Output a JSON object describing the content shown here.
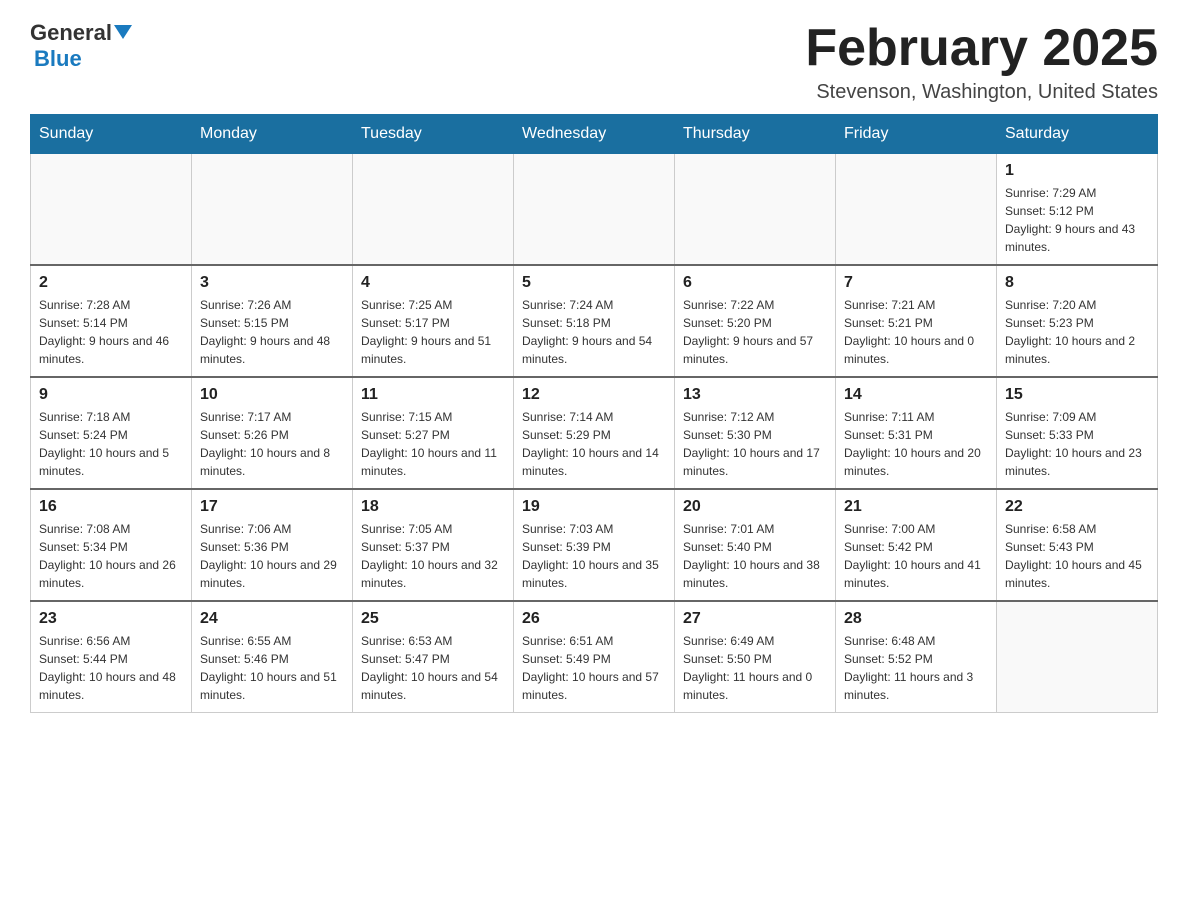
{
  "header": {
    "logo_general": "General",
    "logo_blue": "Blue",
    "month_title": "February 2025",
    "location": "Stevenson, Washington, United States"
  },
  "days_of_week": [
    "Sunday",
    "Monday",
    "Tuesday",
    "Wednesday",
    "Thursday",
    "Friday",
    "Saturday"
  ],
  "weeks": [
    [
      {
        "day": "",
        "info": "",
        "empty": true
      },
      {
        "day": "",
        "info": "",
        "empty": true
      },
      {
        "day": "",
        "info": "",
        "empty": true
      },
      {
        "day": "",
        "info": "",
        "empty": true
      },
      {
        "day": "",
        "info": "",
        "empty": true
      },
      {
        "day": "",
        "info": "",
        "empty": true
      },
      {
        "day": "1",
        "info": "Sunrise: 7:29 AM\nSunset: 5:12 PM\nDaylight: 9 hours and 43 minutes."
      }
    ],
    [
      {
        "day": "2",
        "info": "Sunrise: 7:28 AM\nSunset: 5:14 PM\nDaylight: 9 hours and 46 minutes."
      },
      {
        "day": "3",
        "info": "Sunrise: 7:26 AM\nSunset: 5:15 PM\nDaylight: 9 hours and 48 minutes."
      },
      {
        "day": "4",
        "info": "Sunrise: 7:25 AM\nSunset: 5:17 PM\nDaylight: 9 hours and 51 minutes."
      },
      {
        "day": "5",
        "info": "Sunrise: 7:24 AM\nSunset: 5:18 PM\nDaylight: 9 hours and 54 minutes."
      },
      {
        "day": "6",
        "info": "Sunrise: 7:22 AM\nSunset: 5:20 PM\nDaylight: 9 hours and 57 minutes."
      },
      {
        "day": "7",
        "info": "Sunrise: 7:21 AM\nSunset: 5:21 PM\nDaylight: 10 hours and 0 minutes."
      },
      {
        "day": "8",
        "info": "Sunrise: 7:20 AM\nSunset: 5:23 PM\nDaylight: 10 hours and 2 minutes."
      }
    ],
    [
      {
        "day": "9",
        "info": "Sunrise: 7:18 AM\nSunset: 5:24 PM\nDaylight: 10 hours and 5 minutes."
      },
      {
        "day": "10",
        "info": "Sunrise: 7:17 AM\nSunset: 5:26 PM\nDaylight: 10 hours and 8 minutes."
      },
      {
        "day": "11",
        "info": "Sunrise: 7:15 AM\nSunset: 5:27 PM\nDaylight: 10 hours and 11 minutes."
      },
      {
        "day": "12",
        "info": "Sunrise: 7:14 AM\nSunset: 5:29 PM\nDaylight: 10 hours and 14 minutes."
      },
      {
        "day": "13",
        "info": "Sunrise: 7:12 AM\nSunset: 5:30 PM\nDaylight: 10 hours and 17 minutes."
      },
      {
        "day": "14",
        "info": "Sunrise: 7:11 AM\nSunset: 5:31 PM\nDaylight: 10 hours and 20 minutes."
      },
      {
        "day": "15",
        "info": "Sunrise: 7:09 AM\nSunset: 5:33 PM\nDaylight: 10 hours and 23 minutes."
      }
    ],
    [
      {
        "day": "16",
        "info": "Sunrise: 7:08 AM\nSunset: 5:34 PM\nDaylight: 10 hours and 26 minutes."
      },
      {
        "day": "17",
        "info": "Sunrise: 7:06 AM\nSunset: 5:36 PM\nDaylight: 10 hours and 29 minutes."
      },
      {
        "day": "18",
        "info": "Sunrise: 7:05 AM\nSunset: 5:37 PM\nDaylight: 10 hours and 32 minutes."
      },
      {
        "day": "19",
        "info": "Sunrise: 7:03 AM\nSunset: 5:39 PM\nDaylight: 10 hours and 35 minutes."
      },
      {
        "day": "20",
        "info": "Sunrise: 7:01 AM\nSunset: 5:40 PM\nDaylight: 10 hours and 38 minutes."
      },
      {
        "day": "21",
        "info": "Sunrise: 7:00 AM\nSunset: 5:42 PM\nDaylight: 10 hours and 41 minutes."
      },
      {
        "day": "22",
        "info": "Sunrise: 6:58 AM\nSunset: 5:43 PM\nDaylight: 10 hours and 45 minutes."
      }
    ],
    [
      {
        "day": "23",
        "info": "Sunrise: 6:56 AM\nSunset: 5:44 PM\nDaylight: 10 hours and 48 minutes."
      },
      {
        "day": "24",
        "info": "Sunrise: 6:55 AM\nSunset: 5:46 PM\nDaylight: 10 hours and 51 minutes."
      },
      {
        "day": "25",
        "info": "Sunrise: 6:53 AM\nSunset: 5:47 PM\nDaylight: 10 hours and 54 minutes."
      },
      {
        "day": "26",
        "info": "Sunrise: 6:51 AM\nSunset: 5:49 PM\nDaylight: 10 hours and 57 minutes."
      },
      {
        "day": "27",
        "info": "Sunrise: 6:49 AM\nSunset: 5:50 PM\nDaylight: 11 hours and 0 minutes."
      },
      {
        "day": "28",
        "info": "Sunrise: 6:48 AM\nSunset: 5:52 PM\nDaylight: 11 hours and 3 minutes."
      },
      {
        "day": "",
        "info": "",
        "empty": true
      }
    ]
  ]
}
